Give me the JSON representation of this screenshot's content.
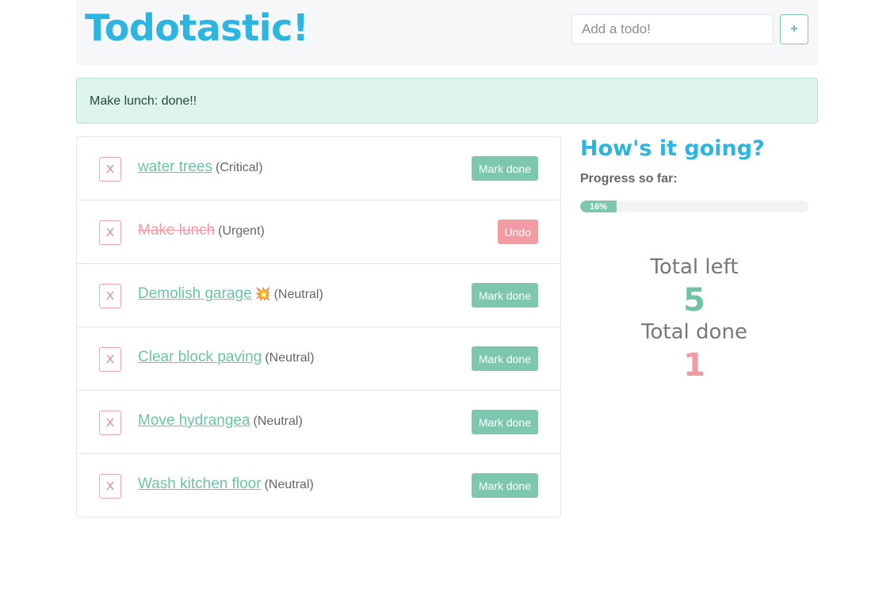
{
  "header": {
    "title": "Todotastic!",
    "input_placeholder": "Add a todo!",
    "add_button_icon": "plus-icon",
    "add_button_glyph": "+"
  },
  "alert": {
    "message": "Make lunch: done!!"
  },
  "todos": [
    {
      "delete_label": "X",
      "text": "water trees",
      "emoji": "",
      "priority": "(Critical)",
      "done": false,
      "action_label": "Mark done"
    },
    {
      "delete_label": "X",
      "text": "Make lunch",
      "emoji": "",
      "priority": "(Urgent)",
      "done": true,
      "action_label": "Undo"
    },
    {
      "delete_label": "X",
      "text": "Demolish garage",
      "emoji": "💥",
      "priority": "(Neutral)",
      "done": false,
      "action_label": "Mark done"
    },
    {
      "delete_label": "X",
      "text": "Clear block paving",
      "emoji": "",
      "priority": "(Neutral)",
      "done": false,
      "action_label": "Mark done"
    },
    {
      "delete_label": "X",
      "text": "Move hydrangea",
      "emoji": "",
      "priority": "(Neutral)",
      "done": false,
      "action_label": "Mark done"
    },
    {
      "delete_label": "X",
      "text": "Wash kitchen floor",
      "emoji": "",
      "priority": "(Neutral)",
      "done": false,
      "action_label": "Mark done"
    }
  ],
  "sidebar": {
    "title": "How's it going?",
    "progress_label": "Progress so far:",
    "progress_percent": 16,
    "progress_text": "16%",
    "total_left_label": "Total left",
    "total_left": "5",
    "total_done_label": "Total done",
    "total_done": "1"
  },
  "colors": {
    "brand": "#2bb5e0",
    "success": "#7cc7ae",
    "danger": "#f29ba2"
  }
}
